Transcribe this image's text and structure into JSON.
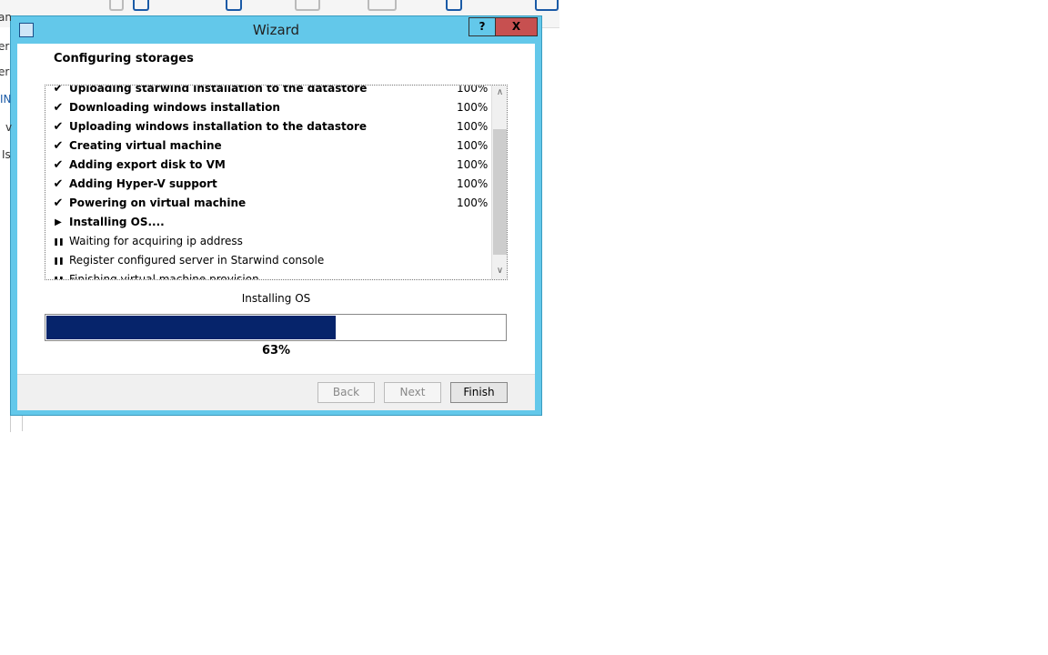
{
  "window": {
    "title": "Wizard",
    "help_label": "?",
    "close_label": "X"
  },
  "background": {
    "left_texts": [
      "an",
      "er",
      "er",
      "IN",
      "v",
      "Is"
    ]
  },
  "heading": "Configuring storages",
  "steps": [
    {
      "state": "done",
      "label": "Uploading starwind installation to the datastore",
      "percent": "100%"
    },
    {
      "state": "done",
      "label": "Downloading windows installation",
      "percent": "100%"
    },
    {
      "state": "done",
      "label": "Uploading windows installation to the datastore",
      "percent": "100%"
    },
    {
      "state": "done",
      "label": "Creating virtual machine",
      "percent": "100%"
    },
    {
      "state": "done",
      "label": "Adding export disk to VM",
      "percent": "100%"
    },
    {
      "state": "done",
      "label": "Adding Hyper-V support",
      "percent": "100%"
    },
    {
      "state": "done",
      "label": "Powering on virtual machine",
      "percent": "100%"
    },
    {
      "state": "running",
      "label": "Installing OS....",
      "percent": ""
    },
    {
      "state": "pending",
      "label": "Waiting for acquiring ip address",
      "percent": ""
    },
    {
      "state": "pending",
      "label": "Register configured server in Starwind console",
      "percent": ""
    },
    {
      "state": "pending",
      "label": "Finishing virtual machine provision",
      "percent": ""
    }
  ],
  "progress": {
    "status": "Installing OS",
    "value": 63,
    "label": "63%",
    "color": "#06246b"
  },
  "buttons": {
    "back": "Back",
    "next": "Next",
    "finish": "Finish"
  },
  "colors": {
    "titlebar": "#63c8ea",
    "close": "#c75050"
  }
}
